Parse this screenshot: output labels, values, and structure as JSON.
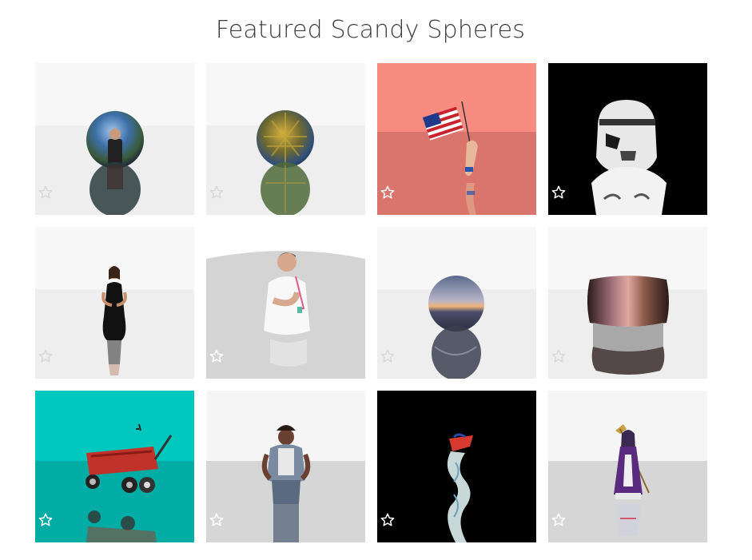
{
  "page": {
    "title": "Featured Scandy Spheres"
  },
  "cards": [
    {
      "subject": "sphere-selfie",
      "background": "light",
      "star_color": "#d8d8d8",
      "favorited": false
    },
    {
      "subject": "sphere-circuit",
      "background": "light",
      "star_color": "#d8d8d8",
      "favorited": false
    },
    {
      "subject": "flag-arm",
      "background": "salmon",
      "star_color": "#ffffff",
      "favorited": false
    },
    {
      "subject": "stormtrooper-helmet",
      "background": "black",
      "star_color": "#ffffff",
      "favorited": false
    },
    {
      "subject": "woman-black-dress",
      "background": "light",
      "star_color": "#d8d8d8",
      "favorited": false
    },
    {
      "subject": "man-white-shirt",
      "background": "gray-dome",
      "star_color": "#ffffff",
      "favorited": false
    },
    {
      "subject": "sphere-sunset",
      "background": "light",
      "star_color": "#d8d8d8",
      "favorited": false
    },
    {
      "subject": "ring-band",
      "background": "light",
      "star_color": "#d8d8d8",
      "favorited": false
    },
    {
      "subject": "red-wagon",
      "background": "teal",
      "star_color": "#ffffff",
      "favorited": false
    },
    {
      "subject": "woman-denim-vest",
      "background": "gray",
      "star_color": "#ffffff",
      "favorited": false
    },
    {
      "subject": "smoke-figure",
      "background": "black",
      "star_color": "#ffffff",
      "favorited": false
    },
    {
      "subject": "costumed-woman-staff",
      "background": "gray",
      "star_color": "#ffffff",
      "favorited": false
    }
  ],
  "colors": {
    "title": "#3c3c3c",
    "light_top": "#f7f7f7",
    "light_bottom": "#eeeeee",
    "salmon_top": "#f98c80",
    "salmon_bottom": "#d9756c",
    "teal_top": "#00c8be",
    "teal_bottom": "#00aca3",
    "gray_top": "#f5f5f5",
    "gray_bottom": "#d6d6d6",
    "black": "#000000"
  }
}
